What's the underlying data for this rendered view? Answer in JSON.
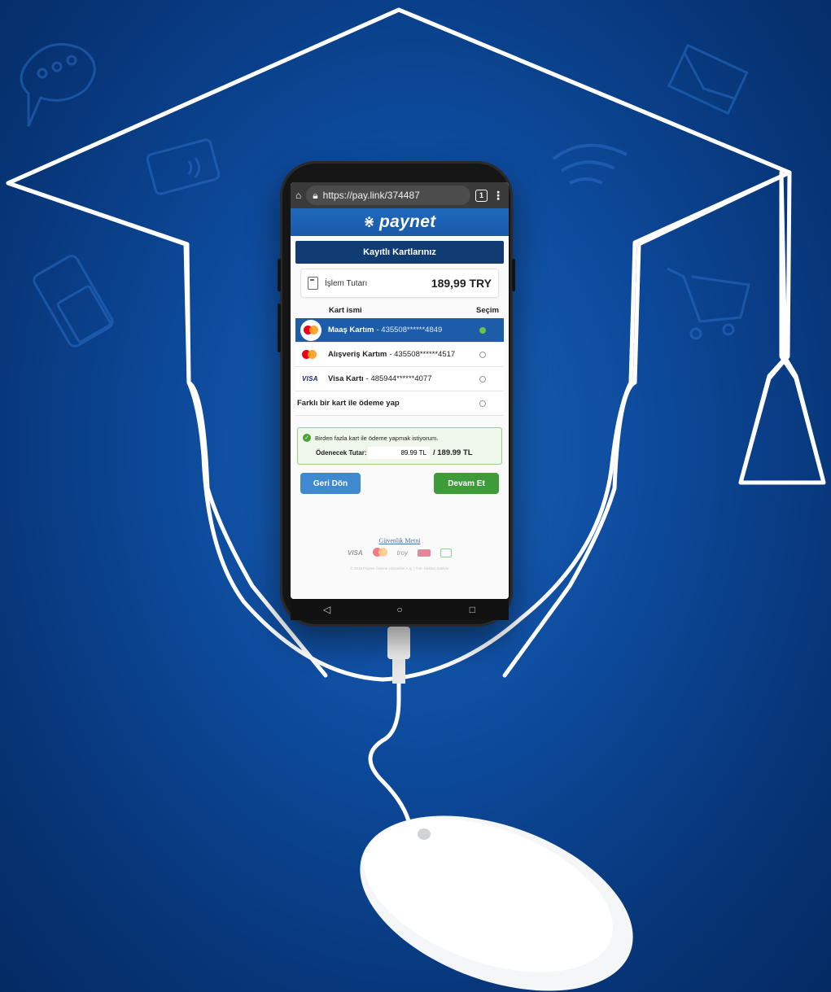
{
  "browser": {
    "url": "https://pay.link/374487",
    "tab_count": "1"
  },
  "brand": {
    "name": "paynet"
  },
  "section": {
    "title": "Kayıtlı Kartlarınız"
  },
  "amount": {
    "label": "İşlem Tutarı",
    "value": "189,99 TRY"
  },
  "table": {
    "col_name": "Kart ismi",
    "col_select": "Seçim"
  },
  "cards": [
    {
      "name": "Maaş Kartım",
      "number": " - 435508******4849",
      "brand": "mastercard",
      "selected": true
    },
    {
      "name": "Alışveriş Kartım",
      "number": " - 435508******4517",
      "brand": "mastercard",
      "selected": false
    },
    {
      "name": "Visa Kartı",
      "number": " - 485944******4077",
      "brand": "visa",
      "selected": false
    }
  ],
  "other_card": {
    "label": "Farklı bir kart ile ödeme yap"
  },
  "split": {
    "checkbox_label": "Birden fazla kart ile ödeme yapmak istiyorum.",
    "amount_label": "Ödenecek Tutar:",
    "amount_value": "89.99 TL",
    "total": "/ 189.99 TL"
  },
  "buttons": {
    "back": "Geri Dön",
    "next": "Devam Et"
  },
  "footer": {
    "security_link": "Güvenlik Metni",
    "visa": "VISA",
    "troy": "troy",
    "copyright": "© 2019 Paynet Ödeme Hizmetleri A.Ş. | Tüm Hakları Saklıdır"
  },
  "colors": {
    "background": "#0d4a9c",
    "brand_bar": "#1f68bd",
    "section_head": "#103b73",
    "selected_row": "#1d5ca8",
    "next_button": "#3e9b3a",
    "back_button": "#3e89d0"
  },
  "icons": [
    "chat-bubble-icon",
    "contactless-card-icon",
    "pos-terminal-icon",
    "wifi-icon",
    "envelope-icon",
    "shopping-cart-icon",
    "graduation-cap-outline",
    "computer-mouse"
  ]
}
